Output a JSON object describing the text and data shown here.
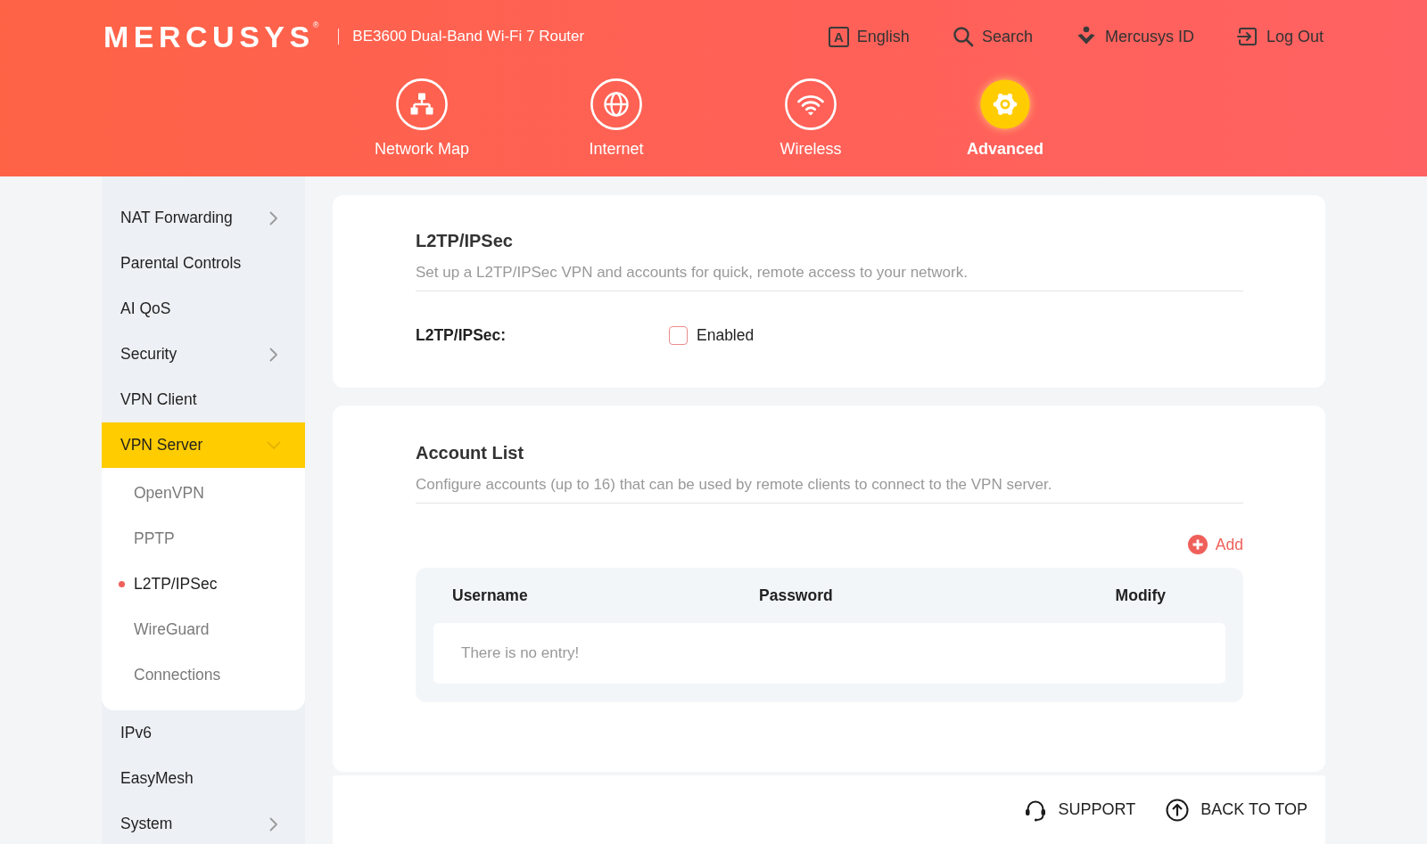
{
  "header": {
    "logo": "MERCUSYS$^{®}$",
    "product": "BE3600 Dual-Band Wi-Fi 7 Router",
    "links": [
      {
        "kind": "language",
        "icon_letter": "A",
        "label": "English"
      },
      {
        "kind": "search",
        "label": "Search"
      },
      {
        "kind": "account",
        "label": "Mercusys ID"
      },
      {
        "kind": "logout",
        "label": "Log Out"
      }
    ]
  },
  "nav": [
    {
      "kind": "network-map",
      "label": "Network Map",
      "selected": false
    },
    {
      "kind": "internet",
      "label": "Internet",
      "selected": false
    },
    {
      "kind": "wireless",
      "label": "Wireless",
      "selected": false
    },
    {
      "kind": "advanced",
      "label": "Advanced",
      "selected": true
    }
  ],
  "sidebar": {
    "items": [
      {
        "label": "NAT Forwarding",
        "submenu": true,
        "expanded": false,
        "selected": false
      },
      {
        "label": "Parental Controls",
        "submenu": false,
        "expanded": false,
        "selected": false
      },
      {
        "label": "AI QoS",
        "submenu": false,
        "expanded": false,
        "selected": false
      },
      {
        "label": "Security",
        "submenu": true,
        "expanded": false,
        "selected": false
      },
      {
        "label": "VPN Client",
        "submenu": false,
        "expanded": false,
        "selected": false
      },
      {
        "label": "VPN Server",
        "submenu": true,
        "expanded": true,
        "selected": true,
        "children": [
          {
            "label": "OpenVPN",
            "selected": false
          },
          {
            "label": "PPTP",
            "selected": false
          },
          {
            "label": "L2TP/IPSec",
            "selected": true
          },
          {
            "label": "WireGuard",
            "selected": false
          },
          {
            "label": "Connections",
            "selected": false
          }
        ]
      },
      {
        "label": "IPv6",
        "submenu": false,
        "expanded": false,
        "selected": false
      },
      {
        "label": "EasyMesh",
        "submenu": false,
        "expanded": false,
        "selected": false
      },
      {
        "label": "System",
        "submenu": true,
        "expanded": false,
        "selected": false
      }
    ]
  },
  "l2tp_card": {
    "title": "L2TP/IPSec",
    "description": "Set up a L2TP/IPSec VPN and accounts for quick, remote access to your network.",
    "field": {
      "label": "L2TP/IPSec:",
      "option": "Enabled",
      "checked": false
    }
  },
  "account_card": {
    "title": "Account List",
    "description": "Configure accounts (up to 16) that can be used by remote clients to connect to the VPN server.",
    "add_button": "Add",
    "table": {
      "columns": [
        "Username",
        "Password",
        "Modify"
      ],
      "empty_message": "There is no entry!"
    }
  },
  "footer": {
    "links": [
      {
        "kind": "support",
        "label": "SUPPORT"
      },
      {
        "kind": "back-to-top",
        "label": "BACK TO TOP"
      }
    ]
  }
}
